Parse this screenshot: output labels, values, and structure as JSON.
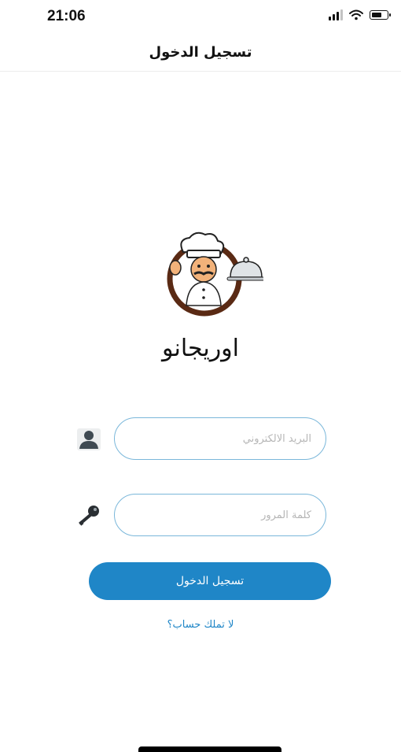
{
  "status_bar": {
    "time": "21:06",
    "icons": [
      "signal-icon",
      "wifi-icon",
      "battery-icon"
    ]
  },
  "nav": {
    "title": "تسجيل الدخول"
  },
  "app": {
    "name": "اوريجانو",
    "logo": "chef-logo"
  },
  "form": {
    "email_placeholder": "البريد الالكتروني",
    "email_value": "",
    "password_placeholder": "كلمة المرور",
    "password_value": "",
    "email_icon": "user-icon",
    "password_icon": "key-icon"
  },
  "login_button_label": "تسجيل الدخول",
  "signup_link": "لا تملك حساب؟",
  "colors": {
    "accent": "#1f86c7",
    "input_border": "#7ab7da",
    "logo_ring": "#5a2a14"
  }
}
